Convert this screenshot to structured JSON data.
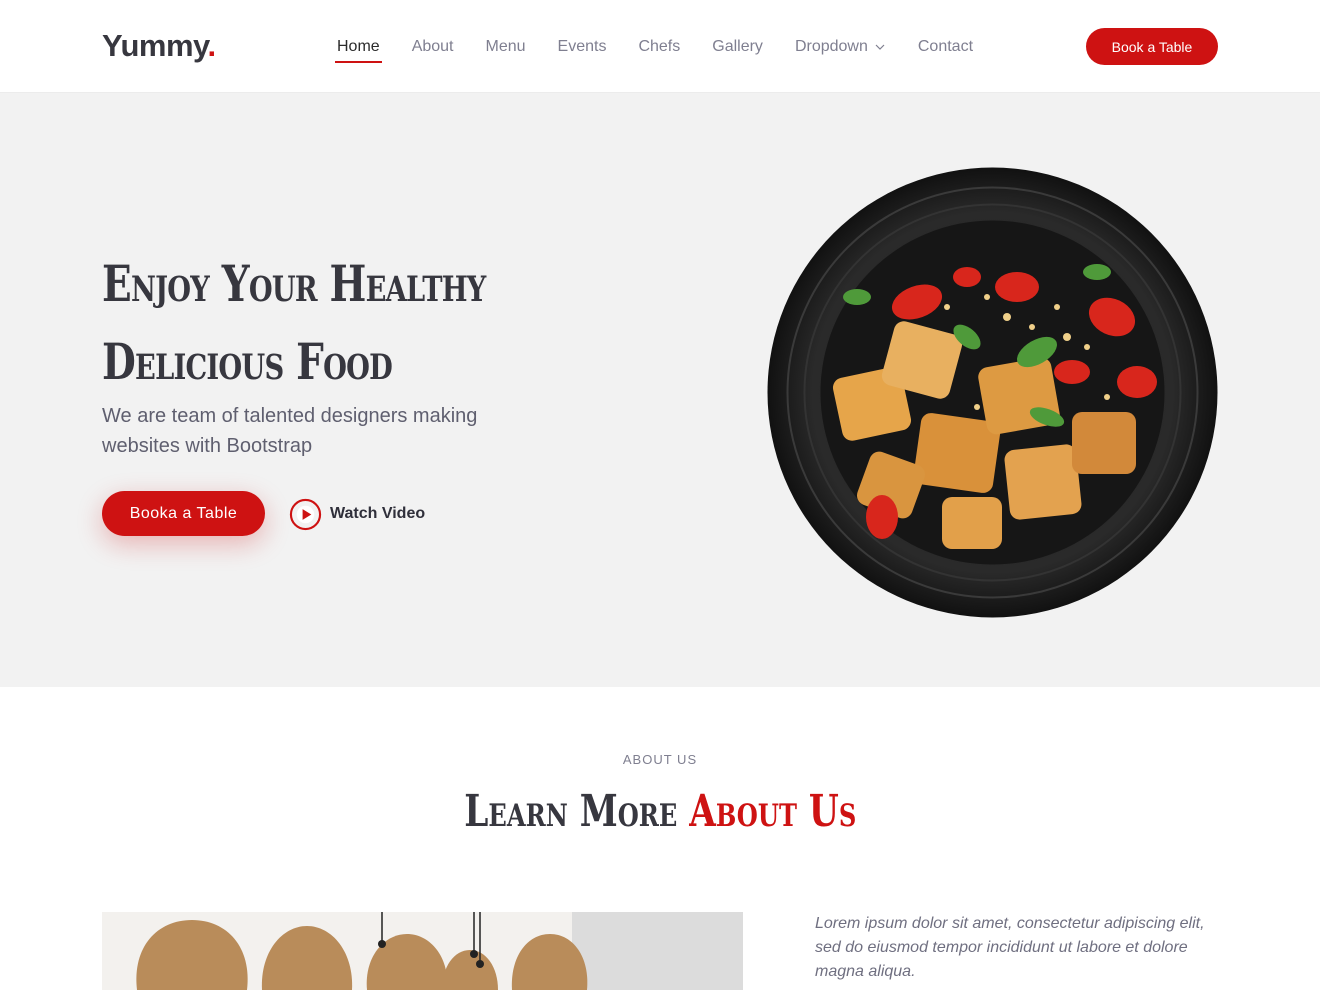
{
  "header": {
    "logo_text": "Yummy",
    "logo_dot": ".",
    "nav": [
      {
        "label": "Home"
      },
      {
        "label": "About"
      },
      {
        "label": "Menu"
      },
      {
        "label": "Events"
      },
      {
        "label": "Chefs"
      },
      {
        "label": "Gallery"
      },
      {
        "label": "Dropdown"
      },
      {
        "label": "Contact"
      }
    ],
    "cta_label": "Book a Table"
  },
  "hero": {
    "title_line1": "Enjoy Your Healthy",
    "title_line2": "Delicious Food",
    "subtitle": "We are team of talented designers making websites with Bootstrap",
    "primary_button": "Booka a Table",
    "video_label": "Watch Video"
  },
  "about": {
    "kicker": "ABOUT US",
    "title_plain": "Learn More ",
    "title_accent": "About Us",
    "intro": "Lorem ipsum dolor sit amet, consectetur adipiscing elit, sed do eiusmod tempor incididunt ut labore et dolore magna aliqua."
  },
  "colors": {
    "accent": "#ce1212",
    "hero_bg": "#f2f2f2",
    "text_dark": "#37373f"
  },
  "icons": {
    "play": "play-circle-icon",
    "dropdown": "chevron-down-icon"
  }
}
